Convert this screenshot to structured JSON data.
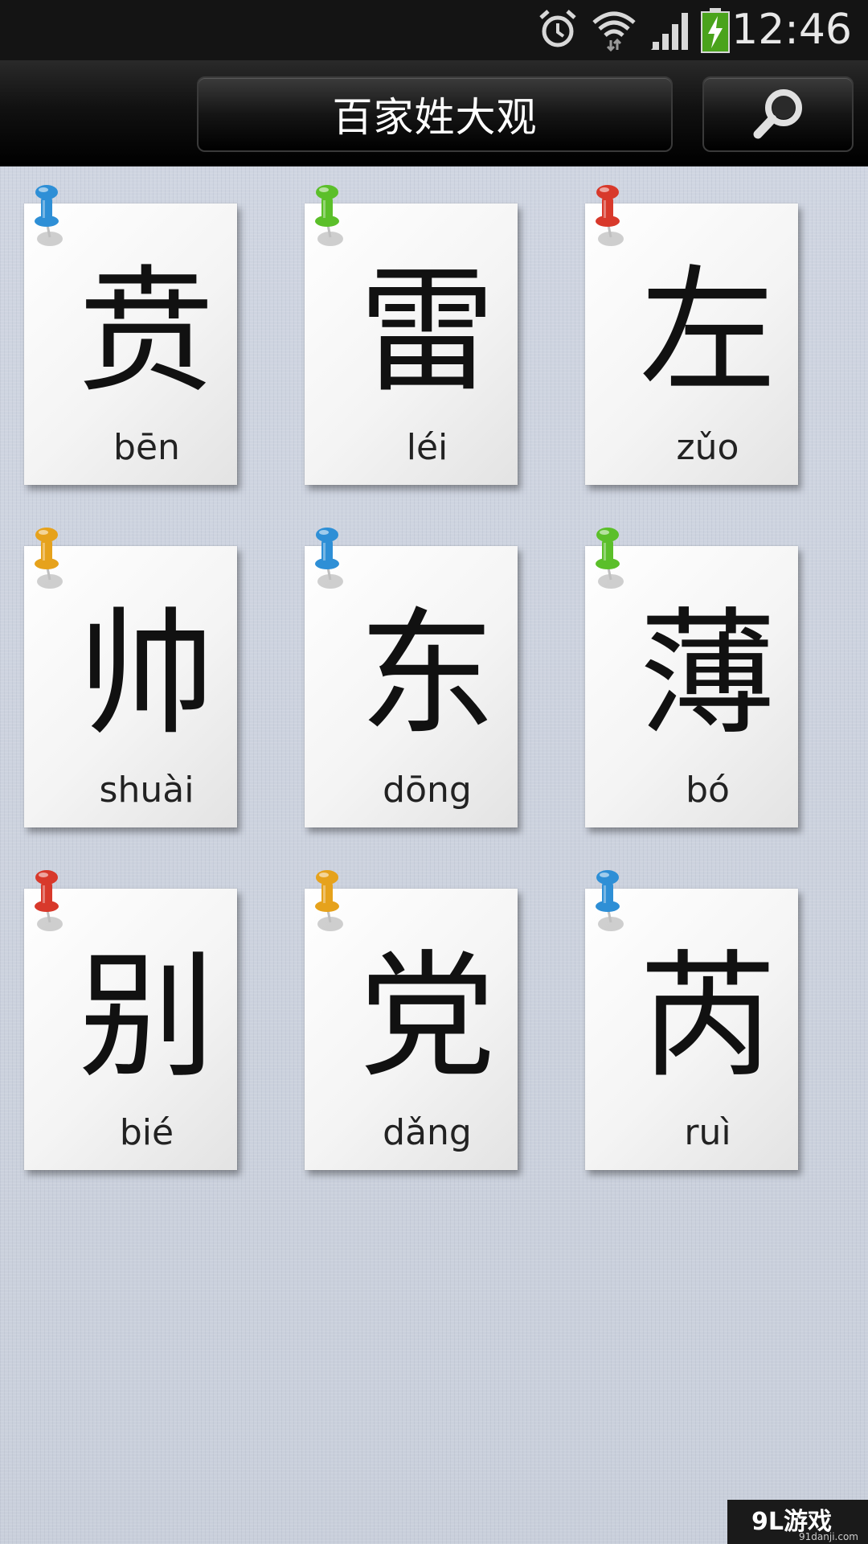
{
  "status_bar": {
    "time": "12:46",
    "icons": [
      "alarm-icon",
      "wifi-icon",
      "signal-icon",
      "battery-charging-icon"
    ]
  },
  "header": {
    "title": "百家姓大观",
    "search_icon": "search-icon"
  },
  "cards": [
    {
      "char": "贲",
      "pinyin": "bēn",
      "pin_color": "#2e8fd6"
    },
    {
      "char": "雷",
      "pinyin": "léi",
      "pin_color": "#5bbf2a"
    },
    {
      "char": "左",
      "pinyin": "zǔo",
      "pin_color": "#d8392b"
    },
    {
      "char": "帅",
      "pinyin": "shuài",
      "pin_color": "#e6a21c"
    },
    {
      "char": "东",
      "pinyin": "dōng",
      "pin_color": "#2e8fd6"
    },
    {
      "char": "薄",
      "pinyin": "bó",
      "pin_color": "#5bbf2a"
    },
    {
      "char": "别",
      "pinyin": "bié",
      "pin_color": "#d8392b"
    },
    {
      "char": "党",
      "pinyin": "dǎng",
      "pin_color": "#e6a21c"
    },
    {
      "char": "芮",
      "pinyin": "ruì",
      "pin_color": "#2e8fd6"
    }
  ],
  "watermark": {
    "main": "9L游戏",
    "sub": "91danji.com"
  }
}
